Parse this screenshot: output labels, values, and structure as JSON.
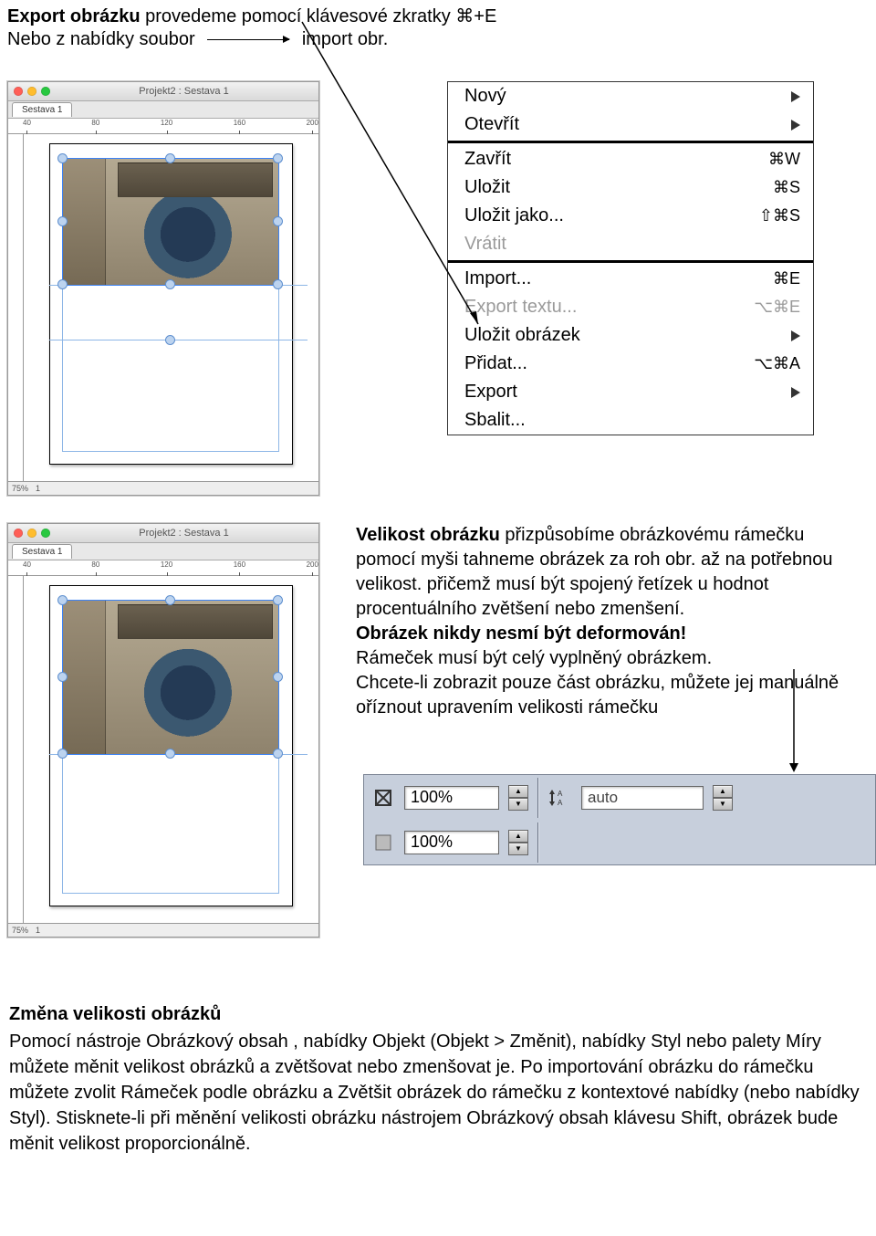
{
  "header": {
    "export_bold": "Export obrázku",
    "export_rest": " provedeme pomocí klávesové zkratky ⌘+E",
    "line2_prefix": "Nebo z nabídky  soubor",
    "import_label": "import obr."
  },
  "editor": {
    "title": "Projekt2 : Sestava 1",
    "tab": "Sestava 1",
    "ruler_h": [
      "40",
      "80",
      "120",
      "160",
      "200"
    ],
    "zoom": "75%",
    "page": "1"
  },
  "menu": {
    "items": [
      {
        "label": "Nový",
        "shortcut": "",
        "arrow": true,
        "disabled": false
      },
      {
        "label": "Otevřít",
        "shortcut": "",
        "arrow": true,
        "disabled": false
      },
      {
        "sep": true
      },
      {
        "label": "Zavřít",
        "shortcut": "⌘W",
        "arrow": false,
        "disabled": false
      },
      {
        "label": "Uložit",
        "shortcut": "⌘S",
        "arrow": false,
        "disabled": false
      },
      {
        "label": "Uložit jako...",
        "shortcut": "⇧⌘S",
        "arrow": false,
        "disabled": false
      },
      {
        "label": "Vrátit",
        "shortcut": "",
        "arrow": false,
        "disabled": true
      },
      {
        "sep": true
      },
      {
        "label": "Import...",
        "shortcut": "⌘E",
        "arrow": false,
        "disabled": false
      },
      {
        "label": "Export textu...",
        "shortcut": "⌥⌘E",
        "arrow": false,
        "disabled": true
      },
      {
        "label": "Uložit obrázek",
        "shortcut": "",
        "arrow": true,
        "disabled": false
      },
      {
        "label": "Přidat...",
        "shortcut": "⌥⌘A",
        "arrow": false,
        "disabled": false
      },
      {
        "label": "Export",
        "shortcut": "",
        "arrow": true,
        "disabled": false
      },
      {
        "label": "Sbalit...",
        "shortcut": "",
        "arrow": false,
        "disabled": false
      }
    ]
  },
  "para": {
    "s1a": "Velikost obrázku",
    "s1b": " přizpůsobíme obrázkovému  rámečku pomocí myši tahneme obrázek za roh obr. až na potřebnou velikost. přičemž musí být spojený řetízek u hodnot procentuálního zvětšení nebo zmenšení.",
    "s2": "Obrázek nikdy nesmí být deformován!",
    "s3": "Rámeček musí být celý vyplněný obrázkem.",
    "s4": "Chcete-li zobrazit pouze část obrázku, můžete jej manuálně oříznout upravením velikosti rámečku"
  },
  "toolbar": {
    "scale_x": "100%",
    "scale_y": "100%",
    "leading": "auto"
  },
  "bottom": {
    "title": "Změna velikosti obrázků",
    "body": "Pomocí nástroje Obrázkový obsah , nabídky Objekt (Objekt > Změnit), nabídky Styl nebo palety Míry můžete měnit velikost obrázků a zvětšovat nebo zmenšovat je. Po importování obrázku do rámečku můžete zvolit Rámeček podle obrázku a Zvětšit obrázek do rámečku z kontextové nabídky (nebo nabídky Styl). Stisknete-li při měnění velikosti obrázku nástrojem Obrázkový obsah klávesu Shift, obrázek bude měnit velikost proporcionálně."
  }
}
